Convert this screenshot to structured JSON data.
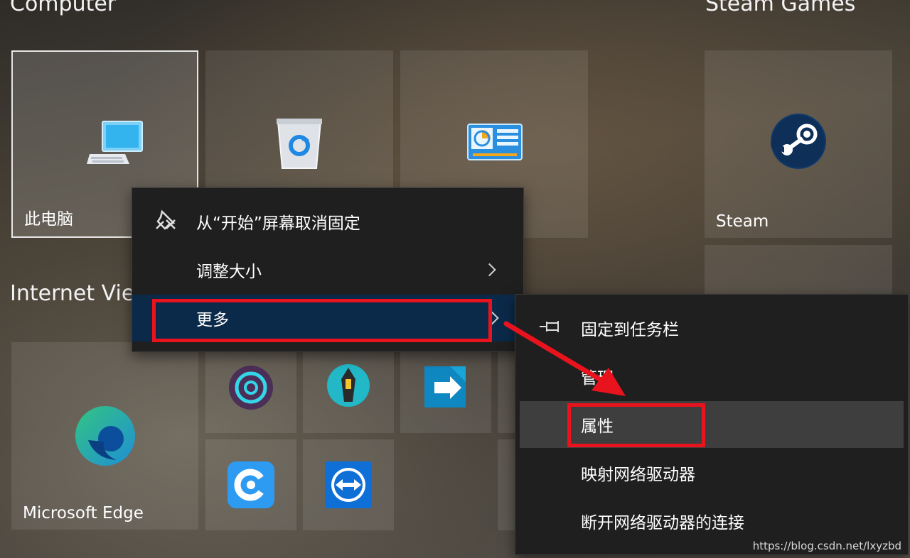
{
  "groups": {
    "computer_title": "Computer",
    "steam_title": "Steam Games",
    "internet_title": "Internet Vie"
  },
  "tiles": {
    "this_pc": "此电脑",
    "steam": "Steam",
    "edge": "Microsoft Edge"
  },
  "context_menu": {
    "items": [
      {
        "label": "从“开始”屏幕取消固定"
      },
      {
        "label": "调整大小"
      },
      {
        "label": "更多"
      }
    ]
  },
  "submenu": {
    "items": [
      {
        "label": "固定到任务栏"
      },
      {
        "label": "管理"
      },
      {
        "label": "属性"
      },
      {
        "label": "映射网络驱动器"
      },
      {
        "label": "断开网络驱动器的连接"
      }
    ]
  },
  "watermark": "https://blog.csdn.net/lxyzbd",
  "colors": {
    "annotation_red": "#e8131d",
    "highlight_blue": "#0b2a4a"
  }
}
